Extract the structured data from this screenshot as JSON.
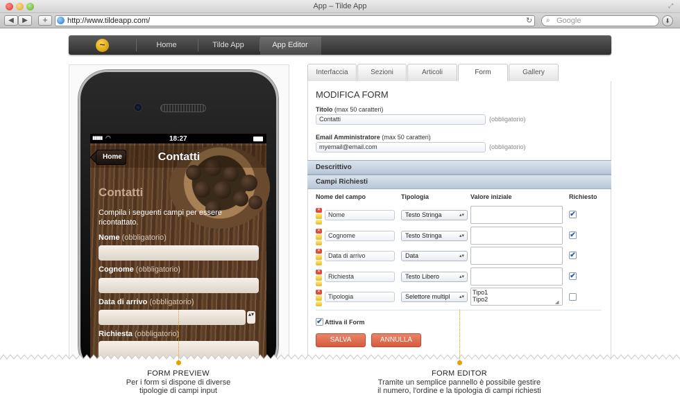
{
  "window": {
    "title": "App – Tilde App"
  },
  "toolbar": {
    "back_icon": "left-triangle-icon",
    "forward_icon": "right-triangle-icon",
    "add_tab_label": "+",
    "url": "http://www.tildeapp.com/",
    "reload_label": "↻",
    "search_placeholder": "Google",
    "download_label": "⬇"
  },
  "site_nav": {
    "logo_glyph": "~",
    "items": [
      {
        "label": "Home"
      },
      {
        "label": "Tilde App"
      },
      {
        "label": "App Editor"
      }
    ],
    "active_index": 2
  },
  "phone": {
    "status_time": "18:27",
    "status_signal": "▮▮▮▮▮",
    "status_wifi": "wifi",
    "back_label": "Home",
    "title": "Contatti",
    "heading": "Contatti",
    "intro": "Compila i seguenti campi per essere ricontattato.",
    "fields": [
      {
        "label": "Nome",
        "hint": "(obbligatorio)"
      },
      {
        "label": "Cognome",
        "hint": "(obbligatorio)"
      },
      {
        "label": "Data di arrivo",
        "hint": "(obbligatorio)"
      },
      {
        "label": "Richiesta",
        "hint": "(obbligatorio)"
      }
    ],
    "stepper_glyph": "▴▾"
  },
  "editor": {
    "tabs": [
      {
        "label": "Interfaccia"
      },
      {
        "label": "Sezioni"
      },
      {
        "label": "Articoli"
      },
      {
        "label": "Form"
      },
      {
        "label": "Gallery"
      }
    ],
    "active_tab": 3,
    "title": "MODIFICA FORM",
    "titolo_label": "Titolo",
    "titolo_max": "(max 50 caratteri)",
    "titolo_value": "Contatti",
    "email_label": "Email Amministratore",
    "email_max": "(max 50 caratteri)",
    "email_value": "myemail@email.com",
    "required_hint": "(obbligatorio)",
    "section_descrittivo": "Descrittivo",
    "section_campi": "Campi Richiesti",
    "columns": {
      "name": "Nome del campo",
      "type": "Tipologia",
      "initial": "Valore iniziale",
      "required": "Richiesto"
    },
    "rows": [
      {
        "name": "Nome",
        "type": "Testo Stringa",
        "initial": "",
        "required": true
      },
      {
        "name": "Cognome",
        "type": "Testo Stringa",
        "initial": "",
        "required": true
      },
      {
        "name": "Data di arrivo",
        "type": "Data",
        "initial": "",
        "required": true
      },
      {
        "name": "Richiesta",
        "type": "Testo Libero",
        "initial": "",
        "required": true
      },
      {
        "name": "Tipologia",
        "type": "Selettore multipl",
        "initial": "Tipo1\nTipo2",
        "required": false
      }
    ],
    "activate_label": "Attiva il Form",
    "activate_checked": true,
    "save_label": "SALVA",
    "cancel_label": "ANNULLA"
  },
  "captions": {
    "preview_title": "FORM PREVIEW",
    "preview_text_1": "Per i form si dispone di diverse",
    "preview_text_2": "tipologie di campi input",
    "editor_title": "FORM EDITOR",
    "editor_text_1": "Tramite un semplice pannello è possibile gestire",
    "editor_text_2": "il numero, l'ordine e la tipologia di campi richiesti"
  },
  "colors": {
    "accent_orange": "#e6a100",
    "button_red": "#d75a3c",
    "section_blue": "#b6c6d7",
    "checkbox_blue": "#1f5fae"
  }
}
